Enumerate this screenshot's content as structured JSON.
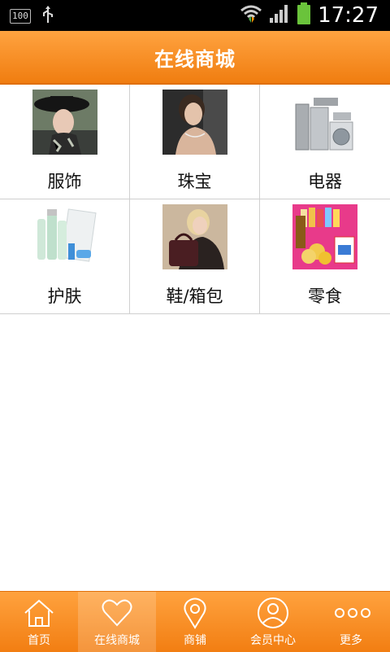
{
  "status_bar": {
    "battery_level_text": "100",
    "time": "17:27"
  },
  "header": {
    "title": "在线商城"
  },
  "categories": [
    {
      "label": "服饰",
      "icon": "fashion-photo"
    },
    {
      "label": "珠宝",
      "icon": "jewelry-photo"
    },
    {
      "label": "电器",
      "icon": "appliances-photo"
    },
    {
      "label": "护肤",
      "icon": "skincare-photo"
    },
    {
      "label": "鞋/箱包",
      "icon": "bags-photo"
    },
    {
      "label": "零食",
      "icon": "snacks-photo"
    }
  ],
  "tabbar": {
    "items": [
      {
        "label": "首页",
        "icon": "home-icon"
      },
      {
        "label": "在线商城",
        "icon": "heart-icon",
        "active": true
      },
      {
        "label": "商铺",
        "icon": "location-pin-icon"
      },
      {
        "label": "会员中心",
        "icon": "user-icon"
      },
      {
        "label": "更多",
        "icon": "more-dots-icon"
      }
    ]
  },
  "colors": {
    "accent": "#f58a1f",
    "header_top": "#ffa340",
    "header_bottom": "#f07d10"
  }
}
